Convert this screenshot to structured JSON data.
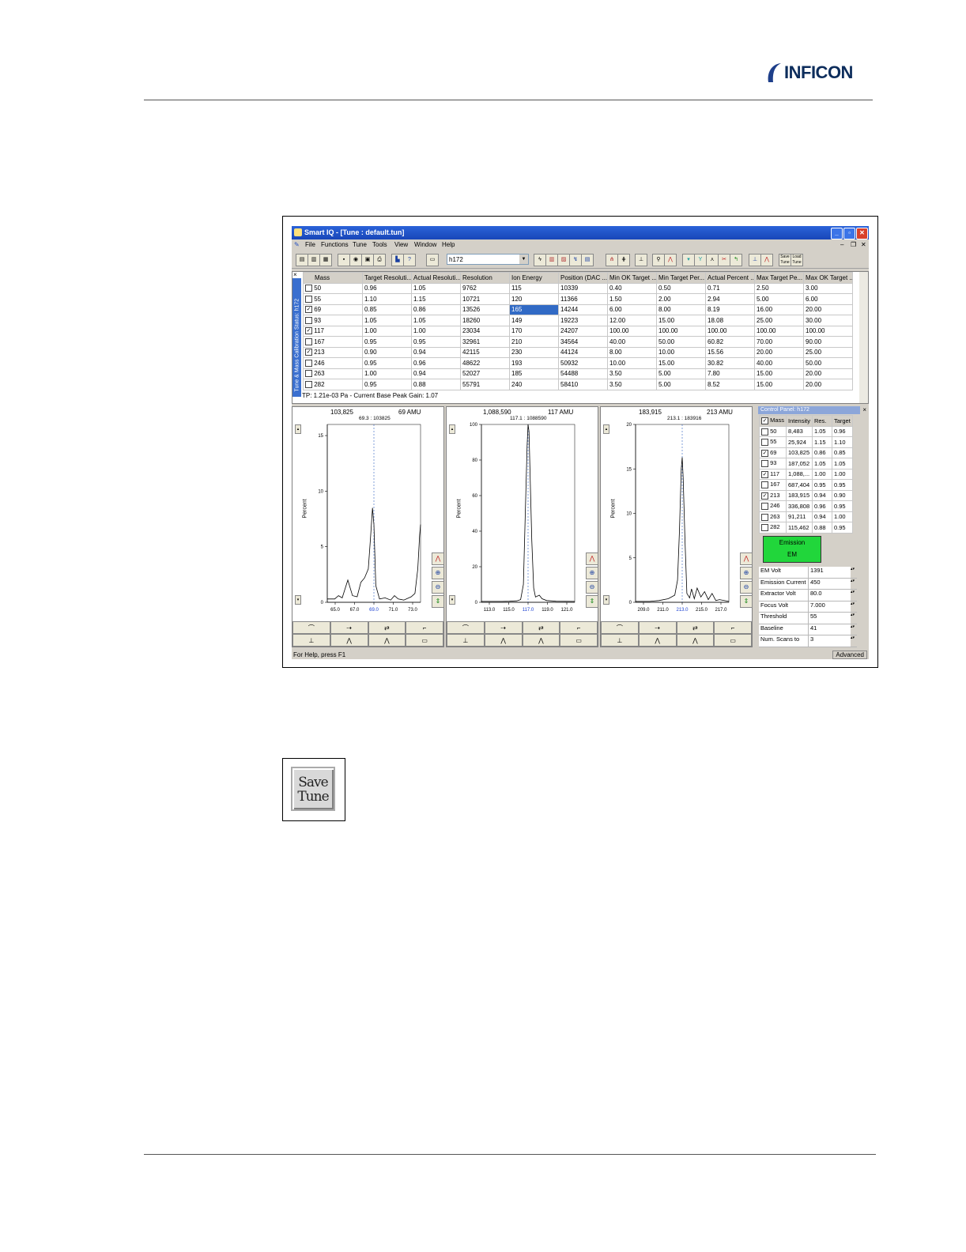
{
  "logo": {
    "word": "INFICON",
    "accent": "#1e3f8a"
  },
  "window": {
    "title": "Smart IQ - [Tune : default.tun]",
    "menu": [
      "File",
      "Functions",
      "Tune",
      "Tools",
      "View",
      "Window",
      "Help"
    ],
    "combo_value": "h172",
    "toolbar_icons": [
      "open-icon",
      "open-folder-icon",
      "report-icon",
      "save-icon",
      "print-preview-icon",
      "export-icon",
      "print-icon",
      "help-icon",
      "help-question-icon",
      "monitor-icon",
      "lightning-icon",
      "chart-icon",
      "chart2-icon",
      "calibrate-icon",
      "graph-icon",
      "peak-left-icon",
      "peak-right-icon",
      "scan-icon",
      "zoom-icon",
      "peak-icon",
      "marker-icon",
      "marker2-icon",
      "shift-icon",
      "tune-icon",
      "tool-icon",
      "baseline-icon",
      "peak-red-icon",
      "save-tune-icon",
      "load-tune-icon"
    ],
    "save_tune_tb": "Save Tune",
    "load_tune_tb": "Load Tune"
  },
  "grid": {
    "side_label": "Tune & Mass Calibration Status: h172",
    "columns": [
      "Mass",
      "Target Resoluti...",
      "Actual Resoluti...",
      "Resolution",
      "Ion Energy",
      "Position (DAC ...",
      "Min OK Target ...",
      "Min Target Per...",
      "Actual Percent ...",
      "Max Target Pe...",
      "Max OK Target ..."
    ],
    "rows": [
      {
        "checked": false,
        "cells": [
          "50",
          "0.96",
          "1.05",
          "9762",
          "115",
          "10339",
          "0.40",
          "0.50",
          "0.71",
          "2.50",
          "3.00"
        ]
      },
      {
        "checked": false,
        "cells": [
          "55",
          "1.10",
          "1.15",
          "10721",
          "120",
          "11366",
          "1.50",
          "2.00",
          "2.94",
          "5.00",
          "6.00"
        ]
      },
      {
        "checked": true,
        "cells": [
          "69",
          "0.85",
          "0.86",
          "13526",
          "165",
          "14244",
          "6.00",
          "8.00",
          "8.19",
          "16.00",
          "20.00"
        ]
      },
      {
        "checked": false,
        "cells": [
          "93",
          "1.05",
          "1.05",
          "18260",
          "149",
          "19223",
          "12.00",
          "15.00",
          "18.08",
          "25.00",
          "30.00"
        ]
      },
      {
        "checked": true,
        "cells": [
          "117",
          "1.00",
          "1.00",
          "23034",
          "170",
          "24207",
          "100.00",
          "100.00",
          "100.00",
          "100.00",
          "100.00"
        ]
      },
      {
        "checked": false,
        "cells": [
          "167",
          "0.95",
          "0.95",
          "32961",
          "210",
          "34564",
          "40.00",
          "50.00",
          "60.82",
          "70.00",
          "90.00"
        ]
      },
      {
        "checked": true,
        "cells": [
          "213",
          "0.90",
          "0.94",
          "42115",
          "230",
          "44124",
          "8.00",
          "10.00",
          "15.56",
          "20.00",
          "25.00"
        ]
      },
      {
        "checked": false,
        "cells": [
          "246",
          "0.95",
          "0.96",
          "48622",
          "193",
          "50932",
          "10.00",
          "15.00",
          "30.82",
          "40.00",
          "50.00"
        ]
      },
      {
        "checked": false,
        "cells": [
          "263",
          "1.00",
          "0.94",
          "52027",
          "185",
          "54488",
          "3.50",
          "5.00",
          "7.80",
          "15.00",
          "20.00"
        ]
      },
      {
        "checked": false,
        "cells": [
          "282",
          "0.95",
          "0.88",
          "55791",
          "240",
          "58410",
          "3.50",
          "5.00",
          "8.52",
          "15.00",
          "20.00"
        ]
      }
    ],
    "status": "TP: 1.21e-03 Pa - Current Base Peak Gain: 1.07"
  },
  "panes": [
    {
      "intensity": "103,825",
      "amu": "69 AMU",
      "peak": "69.3 : 103825",
      "ylabel": "Percent",
      "yticks": [
        0,
        5,
        10,
        15
      ],
      "ymax": 16,
      "xticks": [
        "65.0",
        "67.0",
        "69.0",
        "71.0",
        "73.0"
      ],
      "center_tick": 2,
      "profile": [
        [
          0,
          0.3
        ],
        [
          0.08,
          0.3
        ],
        [
          0.12,
          0.6
        ],
        [
          0.16,
          0.4
        ],
        [
          0.22,
          2.0
        ],
        [
          0.27,
          0.6
        ],
        [
          0.32,
          0.5
        ],
        [
          0.36,
          1.8
        ],
        [
          0.4,
          2.2
        ],
        [
          0.44,
          3.0
        ],
        [
          0.465,
          6.0
        ],
        [
          0.485,
          8.5
        ],
        [
          0.5,
          7.0
        ],
        [
          0.52,
          1.5
        ],
        [
          0.56,
          0.3
        ],
        [
          0.62,
          0.4
        ],
        [
          0.68,
          0.2
        ],
        [
          0.72,
          0.6
        ],
        [
          0.76,
          0.3
        ],
        [
          0.82,
          0.2
        ],
        [
          0.9,
          0.5
        ],
        [
          0.94,
          0.8
        ],
        [
          0.97,
          3.0
        ],
        [
          0.99,
          6.0
        ],
        [
          1.0,
          7.0
        ]
      ]
    },
    {
      "intensity": "1,088,590",
      "amu": "117 AMU",
      "peak": "117.1 : 1088590",
      "ylabel": "Percent",
      "yticks": [
        0,
        20,
        40,
        60,
        80,
        100
      ],
      "ymax": 100,
      "xticks": [
        "113.0",
        "115.0",
        "117.0",
        "119.0",
        "121.0"
      ],
      "center_tick": 2,
      "profile": [
        [
          0,
          0.5
        ],
        [
          0.2,
          0.5
        ],
        [
          0.3,
          0.6
        ],
        [
          0.38,
          0.8
        ],
        [
          0.42,
          1.5
        ],
        [
          0.45,
          10
        ],
        [
          0.47,
          50
        ],
        [
          0.49,
          88
        ],
        [
          0.5,
          100
        ],
        [
          0.51,
          96
        ],
        [
          0.52,
          75
        ],
        [
          0.54,
          35
        ],
        [
          0.56,
          8
        ],
        [
          0.58,
          3
        ],
        [
          0.62,
          4
        ],
        [
          0.65,
          2
        ],
        [
          0.7,
          1
        ],
        [
          0.8,
          0.6
        ],
        [
          1.0,
          0.5
        ]
      ]
    },
    {
      "intensity": "183,915",
      "amu": "213 AMU",
      "peak": "213.1 : 183916",
      "ylabel": "Percent",
      "yticks": [
        0,
        5,
        10,
        15,
        20
      ],
      "ymax": 20,
      "xticks": [
        "209.0",
        "211.0",
        "213.0",
        "215.0",
        "217.0"
      ],
      "center_tick": 2,
      "profile": [
        [
          0,
          0.1
        ],
        [
          0.15,
          0.1
        ],
        [
          0.25,
          0.2
        ],
        [
          0.35,
          0.4
        ],
        [
          0.42,
          0.8
        ],
        [
          0.45,
          2.5
        ],
        [
          0.47,
          8
        ],
        [
          0.49,
          15
        ],
        [
          0.5,
          16.3
        ],
        [
          0.51,
          14
        ],
        [
          0.53,
          7
        ],
        [
          0.55,
          1
        ],
        [
          0.58,
          0.5
        ],
        [
          0.6,
          1.5
        ],
        [
          0.63,
          0.4
        ],
        [
          0.66,
          1.6
        ],
        [
          0.7,
          0.6
        ],
        [
          0.74,
          1.2
        ],
        [
          0.78,
          0.3
        ],
        [
          0.82,
          1.0
        ],
        [
          0.86,
          0.2
        ],
        [
          0.9,
          0.3
        ],
        [
          1.0,
          0.1
        ]
      ]
    }
  ],
  "control_panel": {
    "title": "Control Panel: h172",
    "headers": [
      "Mass",
      "Intensity",
      "Res.",
      "Target"
    ],
    "header_checked": true,
    "rows": [
      {
        "checked": false,
        "cells": [
          "50",
          "8,483",
          "1.05",
          "0.96"
        ]
      },
      {
        "checked": false,
        "cells": [
          "55",
          "25,924",
          "1.15",
          "1.10"
        ]
      },
      {
        "checked": true,
        "cells": [
          "69",
          "103,825",
          "0.86",
          "0.85"
        ]
      },
      {
        "checked": false,
        "cells": [
          "93",
          "187,052",
          "1.05",
          "1.05"
        ]
      },
      {
        "checked": true,
        "cells": [
          "117",
          "1,088,...",
          "1.00",
          "1.00"
        ]
      },
      {
        "checked": false,
        "cells": [
          "167",
          "687,404",
          "0.95",
          "0.95"
        ]
      },
      {
        "checked": true,
        "cells": [
          "213",
          "183,915",
          "0.94",
          "0.90"
        ]
      },
      {
        "checked": false,
        "cells": [
          "246",
          "336,808",
          "0.96",
          "0.95"
        ]
      },
      {
        "checked": false,
        "cells": [
          "263",
          "91,211",
          "0.94",
          "1.00"
        ]
      },
      {
        "checked": false,
        "cells": [
          "282",
          "115,462",
          "0.88",
          "0.95"
        ]
      }
    ],
    "emission_label": "Emission",
    "em_label": "EM",
    "emission_color": "#21d63b",
    "params": [
      {
        "label": "EM Volt",
        "value": "1391"
      },
      {
        "label": "Emission Current",
        "value": "450"
      },
      {
        "label": "Extractor Volt",
        "value": "80.0"
      },
      {
        "label": "Focus Volt",
        "value": "7.000"
      },
      {
        "label": "Threshold",
        "value": "55"
      },
      {
        "label": "Baseline",
        "value": "41"
      },
      {
        "label": "Num. Scans to",
        "value": "3"
      }
    ]
  },
  "statusbar": {
    "help": "For Help, press F1",
    "mode": "Advanced"
  },
  "save_tune_button": {
    "line1": "Save",
    "line2": "Tune"
  }
}
